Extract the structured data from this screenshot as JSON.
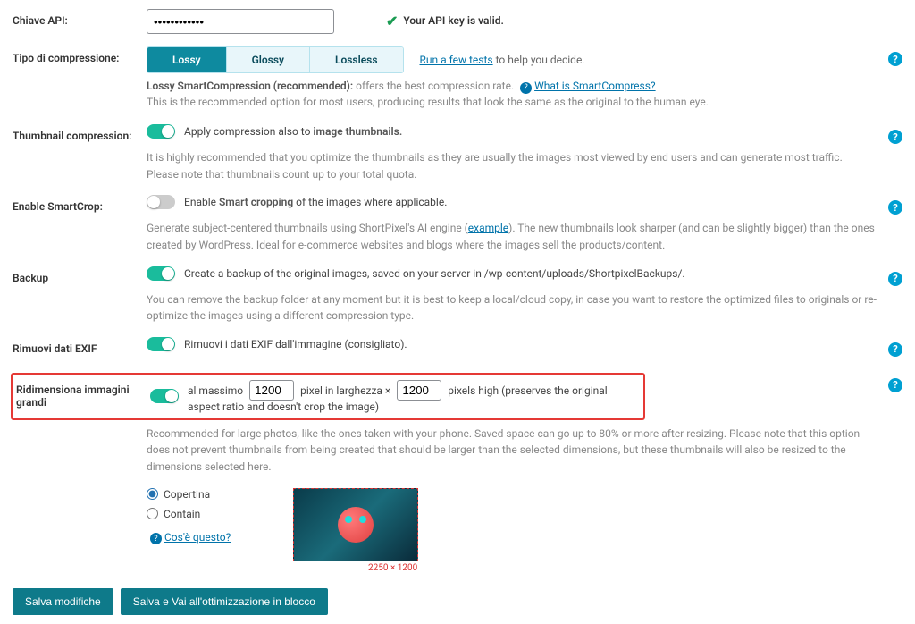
{
  "api": {
    "label": "Chiave API:",
    "valid_msg": "Your API key is valid."
  },
  "compression": {
    "label": "Tipo di compressione:",
    "tabs": [
      "Lossy",
      "Glossy",
      "Lossless"
    ],
    "help_prefix": "Run a few tests",
    "help_suffix": " to help you decide.",
    "desc_lead": "Lossy SmartCompression (recommended): ",
    "desc_rest": "offers the best compression rate. ",
    "desc_link": "What is SmartCompress?",
    "desc2": "This is the recommended option for most users, producing results that look the same as the original to the human eye."
  },
  "thumbnail": {
    "label": "Thumbnail compression:",
    "toggle_pre": "Apply compression also to ",
    "toggle_strong": "image thumbnails.",
    "desc": "It is highly recommended that you optimize the thumbnails as they are usually the images most viewed by end users and can generate most traffic.\nPlease note that thumbnails count up to your total quota."
  },
  "smartcrop": {
    "label": "Enable SmartCrop:",
    "toggle_pre": "Enable ",
    "toggle_strong": "Smart cropping",
    "toggle_post": " of the images where applicable.",
    "desc_pre": "Generate subject-centered thumbnails using ShortPixel's AI engine (",
    "desc_link": "example",
    "desc_post": "). The new thumbnails look sharper (and can be slightly bigger) than the ones created by WordPress. Ideal for e-commerce websites and blogs where the images sell the products/content."
  },
  "backup": {
    "label": "Backup",
    "toggle": "Create a backup of the original images, saved on your server in /wp-content/uploads/ShortpixelBackups/.",
    "desc": "You can remove the backup folder at any moment but it is best to keep a local/cloud copy, in case you want to restore the optimized files to originals or re-optimize the images using a different compression type."
  },
  "exif": {
    "label": "Rimuovi dati EXIF",
    "toggle": "Rimuovi i dati EXIF dall'immagine (consigliato)."
  },
  "resize": {
    "label": "Ridimensiona immagini grandi",
    "pre": "al massimo",
    "w": "1200",
    "mid": "pixel in larghezza ×",
    "h": "1200",
    "post": "pixels high (preserves the original aspect ratio and doesn't crop the image)",
    "desc": "Recommended for large photos, like the ones taken with your phone. Saved space can go up to 80% or more after resizing. Please note that this option does not prevent thumbnails from being created that should be larger than the selected dimensions, but these thumbnails will also be resized to the dimensions selected here.",
    "opt1": "Copertina",
    "opt2": "Contain",
    "whats_this": "Cos'è questo?",
    "preview_dims": "2250 × 1200"
  },
  "buttons": {
    "save": "Salva modifiche",
    "bulk": "Salva e Vai all'ottimizzazione in blocco"
  }
}
